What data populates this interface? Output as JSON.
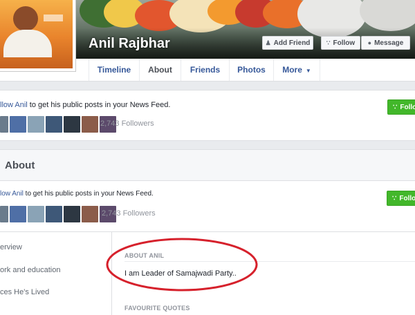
{
  "header": {
    "page_name": "Anil Rajbhar",
    "buttons": [
      {
        "label": "Add Friend",
        "icon": "add-friend-icon"
      },
      {
        "label": "Follow",
        "icon": "rss-icon"
      },
      {
        "label": "Message",
        "icon": "message-icon"
      }
    ]
  },
  "nav": {
    "tabs": [
      "Timeline",
      "About",
      "Friends",
      "Photos",
      "More"
    ],
    "active": "About"
  },
  "follow_card": {
    "link": "llow Anil",
    "text": " to get his public posts in your News Feed.",
    "followers": "2,743 Followers",
    "button_label": "Follo"
  },
  "about": {
    "title": "About",
    "follow_link": "low Anil",
    "follow_text": " to get his public posts in your News Feed.",
    "followers": "2,743 Followers",
    "button_label": "Follo",
    "sidebar": [
      "erview",
      "ork and education",
      "ces He's Lived"
    ],
    "section_label": "ABOUT ANIL",
    "about_text": "I am Leader of Samajwadi Party..",
    "quotes_label": "FAVOURITE QUOTES"
  },
  "colors": {
    "link": "#365899",
    "green": "#42b72a",
    "annotation": "#d6212c"
  }
}
